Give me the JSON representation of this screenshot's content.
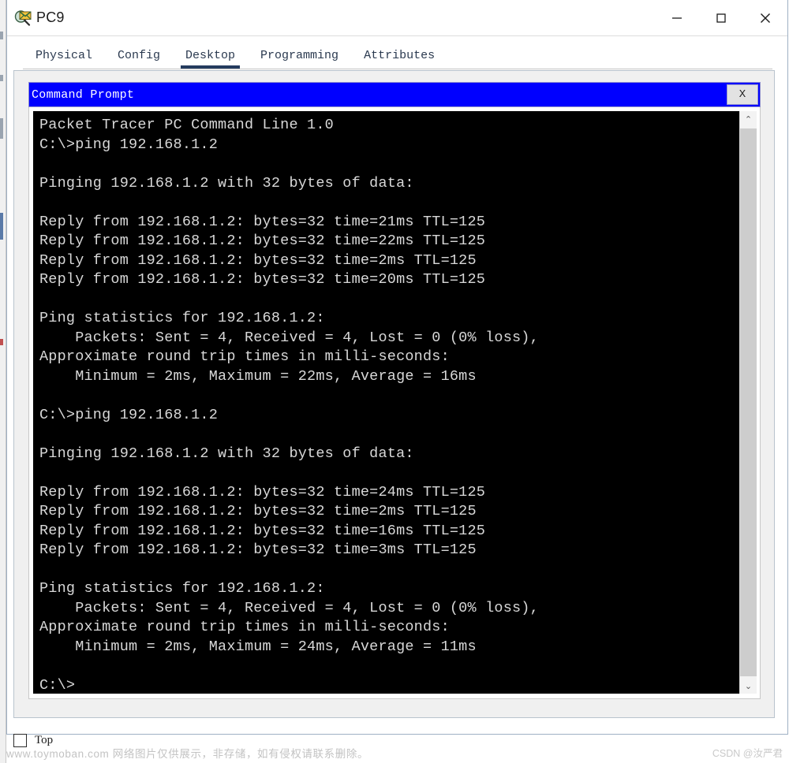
{
  "window": {
    "title": "PC9",
    "icon": "packet-tracer-pc-icon",
    "minimize_label": "─",
    "maximize_label": "□",
    "close_label": "✕"
  },
  "tabs": [
    {
      "label": "Physical",
      "active": false
    },
    {
      "label": "Config",
      "active": false
    },
    {
      "label": "Desktop",
      "active": true
    },
    {
      "label": "Programming",
      "active": false
    },
    {
      "label": "Attributes",
      "active": false
    }
  ],
  "command_prompt": {
    "title": "Command Prompt",
    "close_label": "X",
    "scrollbar": {
      "up_arrow": "⌃",
      "down_arrow": "⌄"
    },
    "terminal_text": "Packet Tracer PC Command Line 1.0\nC:\\>ping 192.168.1.2\n\nPinging 192.168.1.2 with 32 bytes of data:\n\nReply from 192.168.1.2: bytes=32 time=21ms TTL=125\nReply from 192.168.1.2: bytes=32 time=22ms TTL=125\nReply from 192.168.1.2: bytes=32 time=2ms TTL=125\nReply from 192.168.1.2: bytes=32 time=20ms TTL=125\n\nPing statistics for 192.168.1.2:\n    Packets: Sent = 4, Received = 4, Lost = 0 (0% loss),\nApproximate round trip times in milli-seconds:\n    Minimum = 2ms, Maximum = 22ms, Average = 16ms\n\nC:\\>ping 192.168.1.2\n\nPinging 192.168.1.2 with 32 bytes of data:\n\nReply from 192.168.1.2: bytes=32 time=24ms TTL=125\nReply from 192.168.1.2: bytes=32 time=2ms TTL=125\nReply from 192.168.1.2: bytes=32 time=16ms TTL=125\nReply from 192.168.1.2: bytes=32 time=3ms TTL=125\n\nPing statistics for 192.168.1.2:\n    Packets: Sent = 4, Received = 4, Lost = 0 (0% loss),\nApproximate round trip times in milli-seconds:\n    Minimum = 2ms, Maximum = 24ms, Average = 11ms\n\nC:\\>",
    "session": {
      "banner": "Packet Tracer PC Command Line 1.0",
      "prompt": "C:\\>",
      "target_host": "192.168.1.2",
      "runs": [
        {
          "command": "ping 192.168.1.2",
          "pinging_line": "Pinging 192.168.1.2 with 32 bytes of data:",
          "replies": [
            {
              "from": "192.168.1.2",
              "bytes": 32,
              "time_ms": 21,
              "ttl": 125
            },
            {
              "from": "192.168.1.2",
              "bytes": 32,
              "time_ms": 22,
              "ttl": 125
            },
            {
              "from": "192.168.1.2",
              "bytes": 32,
              "time_ms": 2,
              "ttl": 125
            },
            {
              "from": "192.168.1.2",
              "bytes": 32,
              "time_ms": 20,
              "ttl": 125
            }
          ],
          "statistics": {
            "header": "Ping statistics for 192.168.1.2:",
            "sent": 4,
            "received": 4,
            "lost": 0,
            "loss_percent": 0,
            "rtt_header": "Approximate round trip times in milli-seconds:",
            "minimum_ms": 2,
            "maximum_ms": 22,
            "average_ms": 16
          }
        },
        {
          "command": "ping 192.168.1.2",
          "pinging_line": "Pinging 192.168.1.2 with 32 bytes of data:",
          "replies": [
            {
              "from": "192.168.1.2",
              "bytes": 32,
              "time_ms": 24,
              "ttl": 125
            },
            {
              "from": "192.168.1.2",
              "bytes": 32,
              "time_ms": 2,
              "ttl": 125
            },
            {
              "from": "192.168.1.2",
              "bytes": 32,
              "time_ms": 16,
              "ttl": 125
            },
            {
              "from": "192.168.1.2",
              "bytes": 32,
              "time_ms": 3,
              "ttl": 125
            }
          ],
          "statistics": {
            "header": "Ping statistics for 192.168.1.2:",
            "sent": 4,
            "received": 4,
            "lost": 0,
            "loss_percent": 0,
            "rtt_header": "Approximate round trip times in milli-seconds:",
            "minimum_ms": 2,
            "maximum_ms": 24,
            "average_ms": 11
          }
        }
      ]
    }
  },
  "bottom": {
    "top_checkbox_label": "Top",
    "top_checkbox_checked": false
  },
  "watermarks": {
    "left": "www.toymoban.com 网络图片仅供展示，非存储，如有侵权请联系删除。",
    "right": "CSDN @汝严君"
  },
  "colors": {
    "terminal_bg": "#000000",
    "terminal_fg": "#d8d8d8",
    "cmd_titlebar": "#0000ff",
    "tab_active_underline": "#243b5e",
    "panel_bg": "#f0f0f0"
  }
}
